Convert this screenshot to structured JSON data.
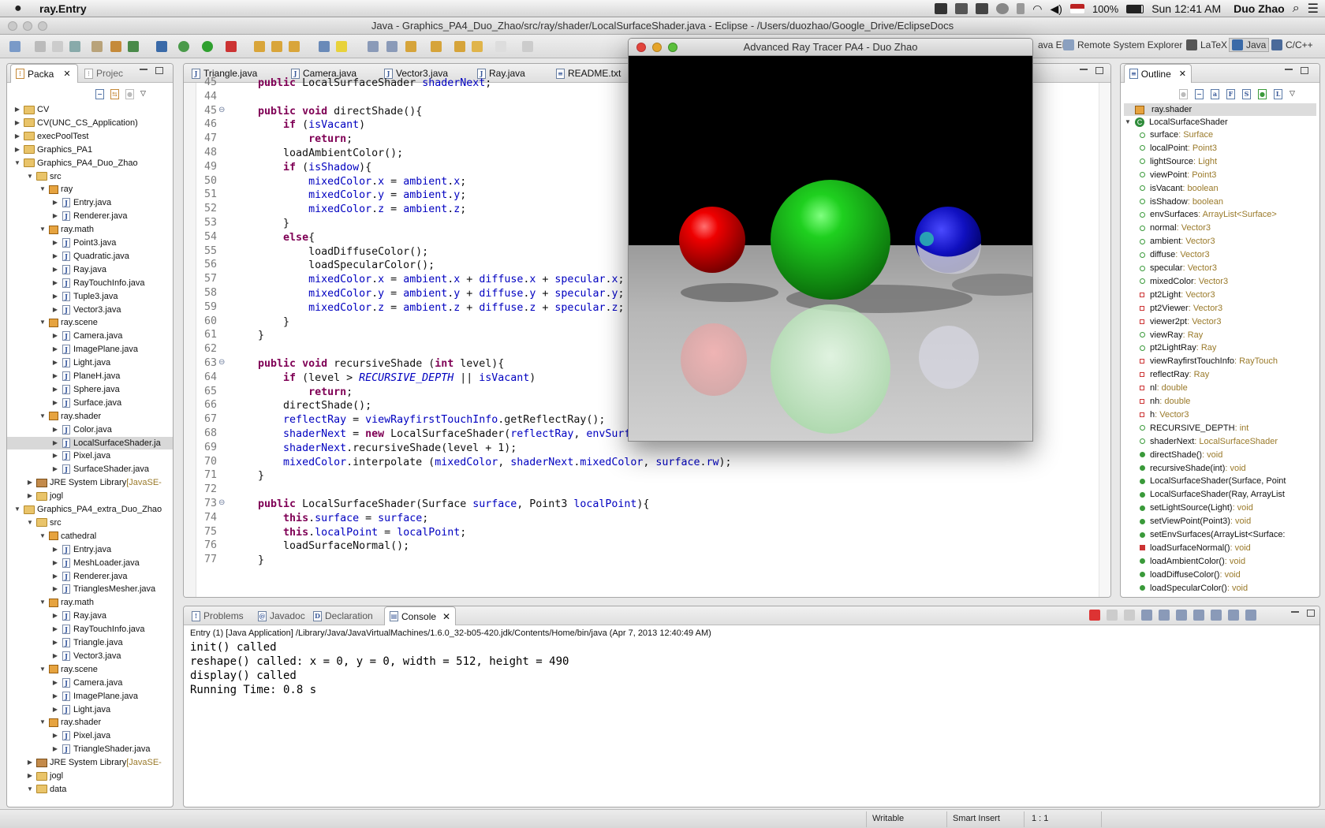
{
  "menubar": {
    "app_name": "ray.Entry",
    "battery": "100%",
    "clock": "Sun 12:41 AM",
    "user": "Duo Zhao"
  },
  "window": {
    "title": "Java - Graphics_PA4_Duo_Zhao/src/ray/shader/LocalSurfaceShader.java - Eclipse - /Users/duozhao/Google_Drive/EclipseDocs"
  },
  "perspectives": {
    "java_ee": "ava EE",
    "remote": "Remote System Explorer",
    "latex": "LaTeX",
    "java": "Java",
    "cpp": "C/C++"
  },
  "explorer": {
    "tab_package": "Packa",
    "tab_project": "Projec",
    "rows": [
      {
        "indent": 0,
        "twisty": "▶",
        "icon": "folder",
        "label": "CV",
        "suffix": ""
      },
      {
        "indent": 0,
        "twisty": "▶",
        "icon": "folder",
        "label": "CV(UNC_CS_Application)",
        "suffix": ""
      },
      {
        "indent": 0,
        "twisty": "▶",
        "icon": "folder",
        "label": "execPoolTest",
        "suffix": ""
      },
      {
        "indent": 0,
        "twisty": "▶",
        "icon": "folder",
        "label": "Graphics_PA1",
        "suffix": ""
      },
      {
        "indent": 0,
        "twisty": "▼",
        "icon": "folder",
        "label": "Graphics_PA4_Duo_Zhao",
        "suffix": ""
      },
      {
        "indent": 1,
        "twisty": "▼",
        "icon": "folder",
        "label": "src",
        "suffix": ""
      },
      {
        "indent": 2,
        "twisty": "▼",
        "icon": "pkg",
        "label": "ray",
        "suffix": ""
      },
      {
        "indent": 3,
        "twisty": "▶",
        "icon": "file",
        "label": "Entry.java",
        "suffix": ""
      },
      {
        "indent": 3,
        "twisty": "▶",
        "icon": "file",
        "label": "Renderer.java",
        "suffix": ""
      },
      {
        "indent": 2,
        "twisty": "▼",
        "icon": "pkg",
        "label": "ray.math",
        "suffix": ""
      },
      {
        "indent": 3,
        "twisty": "▶",
        "icon": "file",
        "label": "Point3.java",
        "suffix": ""
      },
      {
        "indent": 3,
        "twisty": "▶",
        "icon": "file",
        "label": "Quadratic.java",
        "suffix": ""
      },
      {
        "indent": 3,
        "twisty": "▶",
        "icon": "file",
        "label": "Ray.java",
        "suffix": ""
      },
      {
        "indent": 3,
        "twisty": "▶",
        "icon": "file",
        "label": "RayTouchInfo.java",
        "suffix": ""
      },
      {
        "indent": 3,
        "twisty": "▶",
        "icon": "file",
        "label": "Tuple3.java",
        "suffix": ""
      },
      {
        "indent": 3,
        "twisty": "▶",
        "icon": "file",
        "label": "Vector3.java",
        "suffix": ""
      },
      {
        "indent": 2,
        "twisty": "▼",
        "icon": "pkg",
        "label": "ray.scene",
        "suffix": ""
      },
      {
        "indent": 3,
        "twisty": "▶",
        "icon": "file",
        "label": "Camera.java",
        "suffix": ""
      },
      {
        "indent": 3,
        "twisty": "▶",
        "icon": "file",
        "label": "ImagePlane.java",
        "suffix": ""
      },
      {
        "indent": 3,
        "twisty": "▶",
        "icon": "file",
        "label": "Light.java",
        "suffix": ""
      },
      {
        "indent": 3,
        "twisty": "▶",
        "icon": "file",
        "label": "PlaneH.java",
        "suffix": ""
      },
      {
        "indent": 3,
        "twisty": "▶",
        "icon": "file",
        "label": "Sphere.java",
        "suffix": ""
      },
      {
        "indent": 3,
        "twisty": "▶",
        "icon": "file",
        "label": "Surface.java",
        "suffix": ""
      },
      {
        "indent": 2,
        "twisty": "▼",
        "icon": "pkg",
        "label": "ray.shader",
        "suffix": ""
      },
      {
        "indent": 3,
        "twisty": "▶",
        "icon": "file",
        "label": "Color.java",
        "suffix": ""
      },
      {
        "indent": 3,
        "twisty": "▶",
        "icon": "file",
        "label": "LocalSurfaceShader.ja",
        "suffix": "",
        "selected": true
      },
      {
        "indent": 3,
        "twisty": "▶",
        "icon": "file",
        "label": "Pixel.java",
        "suffix": ""
      },
      {
        "indent": 3,
        "twisty": "▶",
        "icon": "file",
        "label": "SurfaceShader.java",
        "suffix": ""
      },
      {
        "indent": 1,
        "twisty": "▶",
        "icon": "lib",
        "label": "JRE System Library",
        "suffix": "[JavaSE-"
      },
      {
        "indent": 1,
        "twisty": "▶",
        "icon": "folder",
        "label": "jogl",
        "suffix": ""
      },
      {
        "indent": 0,
        "twisty": "▼",
        "icon": "folder",
        "label": "Graphics_PA4_extra_Duo_Zhao",
        "suffix": ""
      },
      {
        "indent": 1,
        "twisty": "▼",
        "icon": "folder",
        "label": "src",
        "suffix": ""
      },
      {
        "indent": 2,
        "twisty": "▼",
        "icon": "pkg",
        "label": "cathedral",
        "suffix": ""
      },
      {
        "indent": 3,
        "twisty": "▶",
        "icon": "file",
        "label": "Entry.java",
        "suffix": ""
      },
      {
        "indent": 3,
        "twisty": "▶",
        "icon": "file",
        "label": "MeshLoader.java",
        "suffix": ""
      },
      {
        "indent": 3,
        "twisty": "▶",
        "icon": "file",
        "label": "Renderer.java",
        "suffix": ""
      },
      {
        "indent": 3,
        "twisty": "▶",
        "icon": "file",
        "label": "TrianglesMesher.java",
        "suffix": ""
      },
      {
        "indent": 2,
        "twisty": "▼",
        "icon": "pkg",
        "label": "ray.math",
        "suffix": ""
      },
      {
        "indent": 3,
        "twisty": "▶",
        "icon": "file",
        "label": "Ray.java",
        "suffix": ""
      },
      {
        "indent": 3,
        "twisty": "▶",
        "icon": "file",
        "label": "RayTouchInfo.java",
        "suffix": ""
      },
      {
        "indent": 3,
        "twisty": "▶",
        "icon": "file",
        "label": "Triangle.java",
        "suffix": ""
      },
      {
        "indent": 3,
        "twisty": "▶",
        "icon": "file",
        "label": "Vector3.java",
        "suffix": ""
      },
      {
        "indent": 2,
        "twisty": "▼",
        "icon": "pkg",
        "label": "ray.scene",
        "suffix": ""
      },
      {
        "indent": 3,
        "twisty": "▶",
        "icon": "file",
        "label": "Camera.java",
        "suffix": ""
      },
      {
        "indent": 3,
        "twisty": "▶",
        "icon": "file",
        "label": "ImagePlane.java",
        "suffix": ""
      },
      {
        "indent": 3,
        "twisty": "▶",
        "icon": "file",
        "label": "Light.java",
        "suffix": ""
      },
      {
        "indent": 2,
        "twisty": "▼",
        "icon": "pkg",
        "label": "ray.shader",
        "suffix": ""
      },
      {
        "indent": 3,
        "twisty": "▶",
        "icon": "file",
        "label": "Pixel.java",
        "suffix": ""
      },
      {
        "indent": 3,
        "twisty": "▶",
        "icon": "file",
        "label": "TriangleShader.java",
        "suffix": ""
      },
      {
        "indent": 1,
        "twisty": "▶",
        "icon": "lib",
        "label": "JRE System Library",
        "suffix": "[JavaSE-"
      },
      {
        "indent": 1,
        "twisty": "▶",
        "icon": "folder",
        "label": "jogl",
        "suffix": ""
      },
      {
        "indent": 1,
        "twisty": "▼",
        "icon": "folder",
        "label": "data",
        "suffix": ""
      }
    ]
  },
  "editor": {
    "tabs": [
      "Triangle.java",
      "Camera.java",
      "Vector3.java",
      "Ray.java",
      "README.txt"
    ],
    "lines": [
      {
        "n": "45",
        "fold": "",
        "code": "    public LocalSurfaceShader shaderNext;"
      },
      {
        "n": "44",
        "fold": "",
        "code": ""
      },
      {
        "n": "45",
        "fold": "⊖",
        "code": "    public void directShade(){"
      },
      {
        "n": "46",
        "fold": "",
        "code": "        if (isVacant)"
      },
      {
        "n": "47",
        "fold": "",
        "code": "            return;"
      },
      {
        "n": "48",
        "fold": "",
        "code": "        loadAmbientColor();"
      },
      {
        "n": "49",
        "fold": "",
        "code": "        if (isShadow){"
      },
      {
        "n": "50",
        "fold": "",
        "code": "            mixedColor.x = ambient.x;"
      },
      {
        "n": "51",
        "fold": "",
        "code": "            mixedColor.y = ambient.y;"
      },
      {
        "n": "52",
        "fold": "",
        "code": "            mixedColor.z = ambient.z;"
      },
      {
        "n": "53",
        "fold": "",
        "code": "        }"
      },
      {
        "n": "54",
        "fold": "",
        "code": "        else{"
      },
      {
        "n": "55",
        "fold": "",
        "code": "            loadDiffuseColor();"
      },
      {
        "n": "56",
        "fold": "",
        "code": "            loadSpecularColor();"
      },
      {
        "n": "57",
        "fold": "",
        "code": "            mixedColor.x = ambient.x + diffuse.x + specular.x;"
      },
      {
        "n": "58",
        "fold": "",
        "code": "            mixedColor.y = ambient.y + diffuse.y + specular.y;"
      },
      {
        "n": "59",
        "fold": "",
        "code": "            mixedColor.z = ambient.z + diffuse.z + specular.z;"
      },
      {
        "n": "60",
        "fold": "",
        "code": "        }"
      },
      {
        "n": "61",
        "fold": "",
        "code": "    }"
      },
      {
        "n": "62",
        "fold": "",
        "code": ""
      },
      {
        "n": "63",
        "fold": "⊖",
        "code": "    public void recursiveShade (int level){"
      },
      {
        "n": "64",
        "fold": "",
        "code": "        if (level > RECURSIVE_DEPTH || isVacant)"
      },
      {
        "n": "65",
        "fold": "",
        "code": "            return;"
      },
      {
        "n": "66",
        "fold": "",
        "code": "        directShade();"
      },
      {
        "n": "67",
        "fold": "",
        "code": "        reflectRay = viewRayfirstTouchInfo.getReflectRay();"
      },
      {
        "n": "68",
        "fold": "",
        "code": "        shaderNext = new LocalSurfaceShader(reflectRay, envSurfaces, lightSource);"
      },
      {
        "n": "69",
        "fold": "",
        "code": "        shaderNext.recursiveShade(level + 1);"
      },
      {
        "n": "70",
        "fold": "",
        "code": "        mixedColor.interpolate (mixedColor, shaderNext.mixedColor, surface.rw);"
      },
      {
        "n": "71",
        "fold": "",
        "code": "    }"
      },
      {
        "n": "72",
        "fold": "",
        "code": ""
      },
      {
        "n": "73",
        "fold": "⊖",
        "code": "    public LocalSurfaceShader(Surface surface, Point3 localPoint){"
      },
      {
        "n": "74",
        "fold": "",
        "code": "        this.surface = surface;"
      },
      {
        "n": "75",
        "fold": "",
        "code": "        this.localPoint = localPoint;"
      },
      {
        "n": "76",
        "fold": "",
        "code": "        loadSurfaceNormal();"
      },
      {
        "n": "77",
        "fold": "",
        "code": "    }"
      }
    ]
  },
  "ray_window": {
    "title": "Advanced Ray Tracer PA4 - Duo Zhao"
  },
  "outline": {
    "tab": "Outline",
    "package": "ray.shader",
    "class": "LocalSurfaceShader",
    "members": [
      {
        "kind": "field",
        "name": "surface",
        "type": " : Surface"
      },
      {
        "kind": "field",
        "name": "localPoint",
        "type": " : Point3"
      },
      {
        "kind": "field",
        "name": "lightSource",
        "type": " : Light"
      },
      {
        "kind": "field",
        "name": "viewPoint",
        "type": " : Point3"
      },
      {
        "kind": "field",
        "name": "isVacant",
        "type": " : boolean"
      },
      {
        "kind": "field",
        "name": "isShadow",
        "type": " : boolean"
      },
      {
        "kind": "field",
        "name": "envSurfaces",
        "type": " : ArrayList<Surface>"
      },
      {
        "kind": "field",
        "name": "normal",
        "type": " : Vector3"
      },
      {
        "kind": "field",
        "name": "ambient",
        "type": " : Vector3"
      },
      {
        "kind": "field",
        "name": "diffuse",
        "type": " : Vector3"
      },
      {
        "kind": "field",
        "name": "specular",
        "type": " : Vector3"
      },
      {
        "kind": "field",
        "name": "mixedColor",
        "type": " : Vector3"
      },
      {
        "kind": "private",
        "name": "pt2Light",
        "type": " : Vector3"
      },
      {
        "kind": "private",
        "name": "pt2Viewer",
        "type": " : Vector3"
      },
      {
        "kind": "private",
        "name": "viewer2pt",
        "type": " : Vector3"
      },
      {
        "kind": "field",
        "name": "viewRay",
        "type": " : Ray"
      },
      {
        "kind": "field",
        "name": "pt2LightRay",
        "type": " : Ray"
      },
      {
        "kind": "private",
        "name": "viewRayfirstTouchInfo",
        "type": " : RayTouch"
      },
      {
        "kind": "private",
        "name": "reflectRay",
        "type": " : Ray"
      },
      {
        "kind": "private",
        "name": "nl",
        "type": " : double"
      },
      {
        "kind": "private",
        "name": "nh",
        "type": " : double"
      },
      {
        "kind": "private",
        "name": "h",
        "type": " : Vector3"
      },
      {
        "kind": "static",
        "name": "RECURSIVE_DEPTH",
        "type": " : int"
      },
      {
        "kind": "field",
        "name": "shaderNext",
        "type": " : LocalSurfaceShader"
      },
      {
        "kind": "method",
        "name": "directShade()",
        "type": " : void"
      },
      {
        "kind": "method",
        "name": "recursiveShade(int)",
        "type": " : void"
      },
      {
        "kind": "method",
        "name": "LocalSurfaceShader(Surface, Point",
        "type": ""
      },
      {
        "kind": "method",
        "name": "LocalSurfaceShader(Ray, ArrayList",
        "type": ""
      },
      {
        "kind": "method",
        "name": "setLightSource(Light)",
        "type": " : void"
      },
      {
        "kind": "method",
        "name": "setViewPoint(Point3)",
        "type": " : void"
      },
      {
        "kind": "method",
        "name": "setEnvSurfaces(ArrayList<Surface:",
        "type": ""
      },
      {
        "kind": "privmethod",
        "name": "loadSurfaceNormal()",
        "type": " : void"
      },
      {
        "kind": "method",
        "name": "loadAmbientColor()",
        "type": " : void"
      },
      {
        "kind": "method",
        "name": "loadDiffuseColor()",
        "type": " : void"
      },
      {
        "kind": "method",
        "name": "loadSpecularColor()",
        "type": " : void"
      }
    ]
  },
  "bottom": {
    "tabs": [
      "Problems",
      "Javadoc",
      "Declaration",
      "Console"
    ],
    "console_header": "Entry (1) [Java Application] /Library/Java/JavaVirtualMachines/1.6.0_32-b05-420.jdk/Contents/Home/bin/java (Apr 7, 2013 12:40:49 AM)",
    "console_lines": [
      "init() called",
      "reshape() called: x = 0, y = 0, width = 512, height = 490",
      "display() called",
      "Running Time: 0.8 s"
    ]
  },
  "status": {
    "writable": "Writable",
    "insert_mode": "Smart Insert",
    "position": "1 : 1"
  }
}
